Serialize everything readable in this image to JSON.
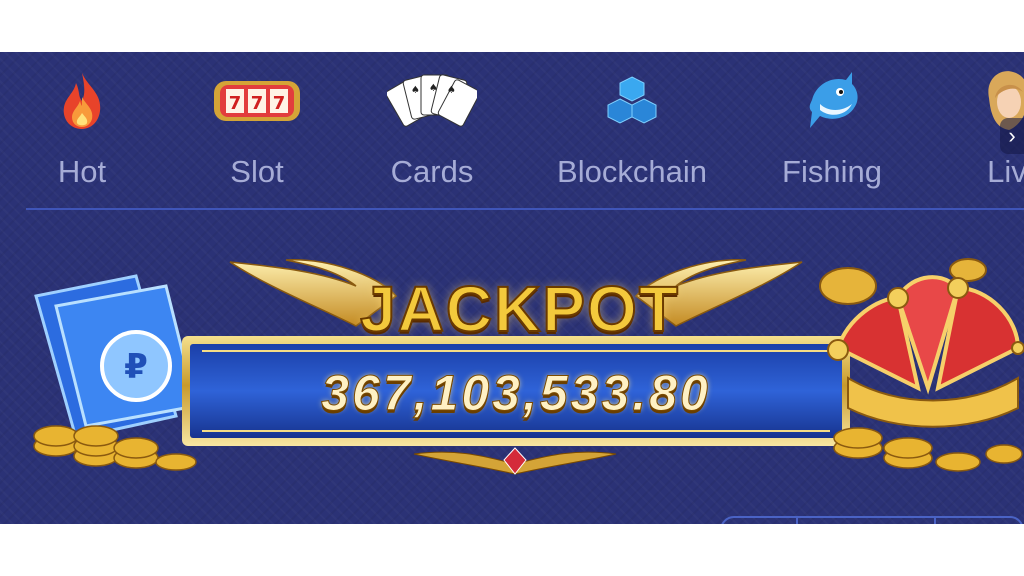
{
  "nav": {
    "items": [
      {
        "label": "Hot",
        "icon": "flame-icon"
      },
      {
        "label": "Slot",
        "icon": "slot-machine-icon"
      },
      {
        "label": "Cards",
        "icon": "playing-cards-icon"
      },
      {
        "label": "Blockchain",
        "icon": "blockchain-icon"
      },
      {
        "label": "Fishing",
        "icon": "shark-icon"
      },
      {
        "label": "Liv",
        "icon": "live-dealer-icon"
      }
    ],
    "next_arrow": "›"
  },
  "jackpot": {
    "title": "JACKPOT",
    "amount": "367,103,533.80"
  },
  "colors": {
    "background": "#2b3276",
    "nav_label": "#a6acd6",
    "divider": "#3f55b8",
    "gold": "#f3c93c",
    "ribbon_blue": "#2f63d8"
  }
}
